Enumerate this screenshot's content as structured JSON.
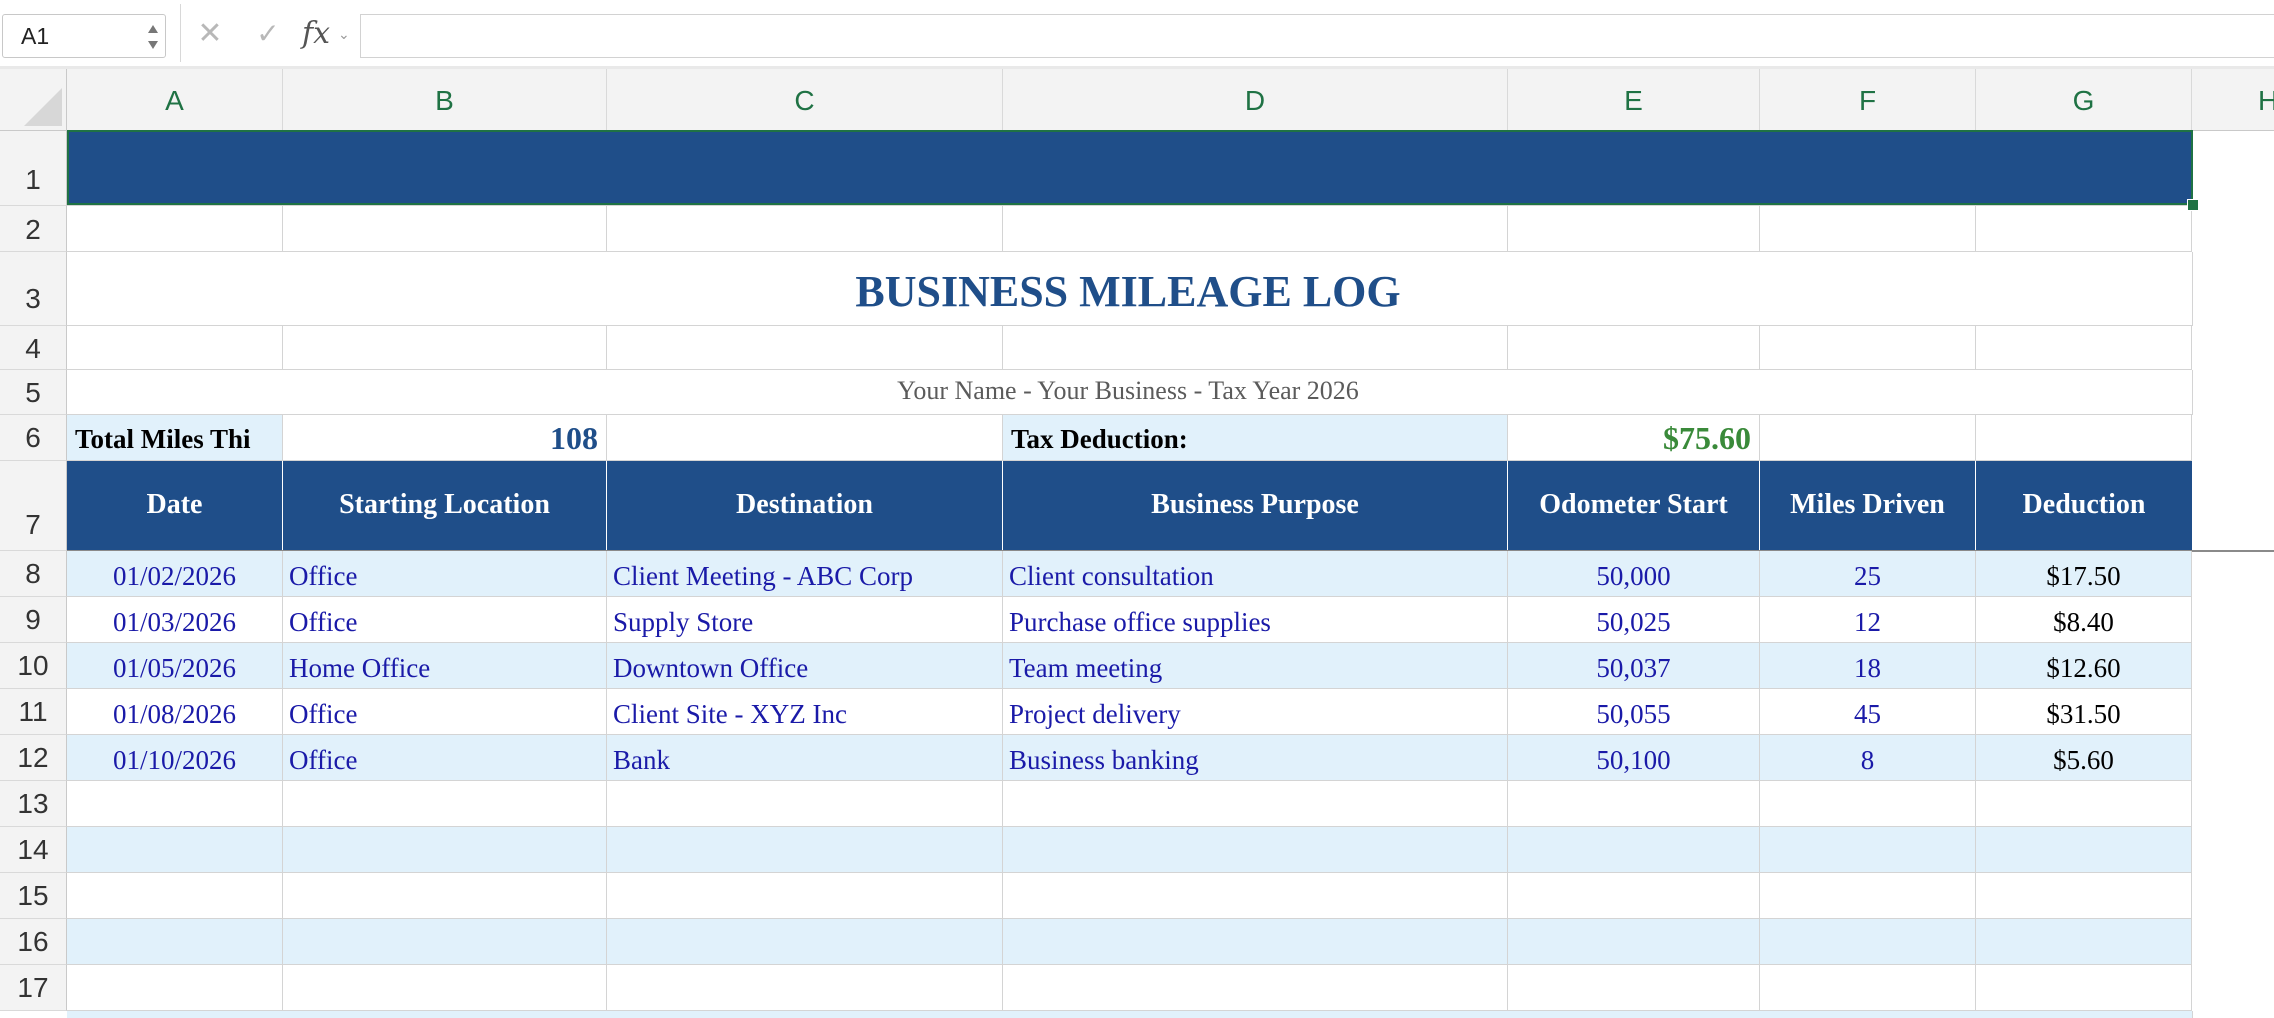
{
  "formula_bar": {
    "name_box": "A1",
    "fx_label": "fx",
    "formula": ""
  },
  "columns": [
    "A",
    "B",
    "C",
    "D",
    "E",
    "F",
    "G",
    "H"
  ],
  "rows": [
    "1",
    "2",
    "3",
    "4",
    "5",
    "6",
    "7",
    "8",
    "9",
    "10",
    "11",
    "12",
    "13",
    "14",
    "15",
    "16",
    "17"
  ],
  "sheet": {
    "title": "BUSINESS MILEAGE LOG",
    "subtitle": "Your Name - Your Business - Tax Year 2026",
    "summary": {
      "total_label": "Total Miles Thi",
      "total_value": "108",
      "deduction_label": "Tax Deduction:",
      "deduction_value": "$75.60"
    },
    "headers": [
      "Date",
      "Starting Location",
      "Destination",
      "Business Purpose",
      "Odometer Start",
      "Miles Driven",
      "Deduction"
    ],
    "entries": [
      {
        "date": "01/02/2026",
        "start": "Office",
        "destination": "Client Meeting - ABC Corp",
        "purpose": "Client consultation",
        "odometer": "50,000",
        "miles": "25",
        "deduction": "$17.50"
      },
      {
        "date": "01/03/2026",
        "start": "Office",
        "destination": "Supply Store",
        "purpose": "Purchase office supplies",
        "odometer": "50,025",
        "miles": "12",
        "deduction": "$8.40"
      },
      {
        "date": "01/05/2026",
        "start": "Home Office",
        "destination": "Downtown Office",
        "purpose": "Team meeting",
        "odometer": "50,037",
        "miles": "18",
        "deduction": "$12.60"
      },
      {
        "date": "01/08/2026",
        "start": "Office",
        "destination": "Client Site - XYZ Inc",
        "purpose": "Project delivery",
        "odometer": "50,055",
        "miles": "45",
        "deduction": "$31.50"
      },
      {
        "date": "01/10/2026",
        "start": "Office",
        "destination": "Bank",
        "purpose": "Business banking",
        "odometer": "50,100",
        "miles": "8",
        "deduction": "$5.60"
      }
    ]
  },
  "colors": {
    "header_fill": "#1f4e89",
    "band_fill": "#e1f1fb",
    "title_color": "#1f4e89",
    "deduction_color": "#3a8a3a",
    "selection_color": "#1f7244"
  }
}
